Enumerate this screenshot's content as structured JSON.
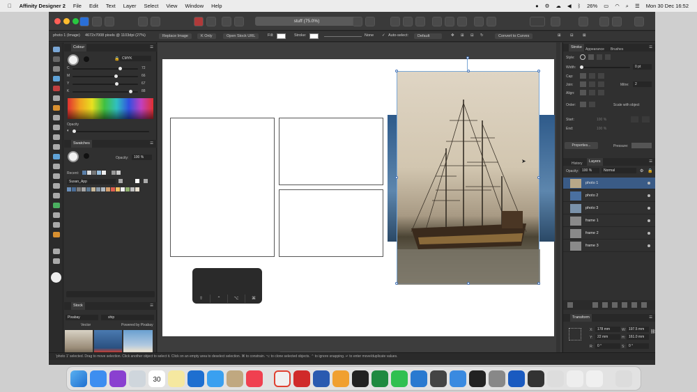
{
  "menubar": {
    "app_name": "Affinity Designer 2",
    "items": [
      "File",
      "Edit",
      "Text",
      "Layer",
      "Select",
      "View",
      "Window",
      "Help"
    ],
    "battery": "26%",
    "clock": "Mon 30 Dec  16:52"
  },
  "toolbar": {
    "document_title": "stuff (75.0%)"
  },
  "context_bar": {
    "info": "photo 1 (Image)",
    "dimensions": "4672x7008 pixels @ 1103dpi (27%)",
    "replace_image": "Replace Image",
    "k_only": "K Only",
    "open_stock_url": "Open Stock URL",
    "fill_label": "Fill:",
    "stroke_label": "Stroke:",
    "stroke_value": "None",
    "auto_select": "Auto-select:",
    "auto_select_value": "Default",
    "convert_to_curves": "Convert to Curves"
  },
  "colour_panel": {
    "tab": "Colour",
    "model": "CMYK",
    "channels": [
      {
        "name": "C",
        "value": "72",
        "level": 0.72
      },
      {
        "name": "M",
        "value": "66",
        "level": 0.66
      },
      {
        "name": "Y",
        "value": "67",
        "level": 0.67
      },
      {
        "name": "K",
        "value": "88",
        "level": 0.88
      }
    ],
    "opacity_label": "Opacity",
    "opacity_value": "100 %"
  },
  "swatches_panel": {
    "tab": "Swatches",
    "opacity_label": "Opacity:",
    "opacity_value": "100 %",
    "recent_label": "Recent:",
    "palette_name": "Susan_App",
    "recent_colors": [
      "#5a7ea8",
      "#e0e0e0",
      "#777777",
      "#9ac0e0",
      "#eeeeee",
      "#333333",
      "#9a9a9a",
      "#cccccc"
    ],
    "palette_colors": [
      "#6b8fb8",
      "#4a6c96",
      "#7d7d7d",
      "#a5a5a5",
      "#5e7a94",
      "#c8b89a",
      "#8a9aa8",
      "#b0b8c0",
      "#d4a070",
      "#e06050",
      "#f0c060",
      "#f0f0f0",
      "#90b070",
      "#c0c0c0",
      "#e8e0d0"
    ]
  },
  "stock_panel": {
    "tab": "Stock",
    "provider": "Pixabay",
    "search_query": "ship",
    "type": "Vector",
    "powered_by": "Powered by Pixabay"
  },
  "stroke_panel": {
    "tabs": [
      "Stroke",
      "Appearance",
      "Brushes"
    ],
    "style_label": "Style:",
    "width_label": "Width:",
    "width_value": "0 pt",
    "cap_label": "Cap:",
    "join_label": "Join:",
    "mitre_label": "Mitre:",
    "mitre_value": "2",
    "align_label": "Align:",
    "order_label": "Order:",
    "scale_with_object": "Scale with object",
    "start_label": "Start:",
    "start_value": "100 %",
    "end_label": "End:",
    "end_value": "100 %",
    "properties_button": "Properties...",
    "pressure_label": "Pressure:"
  },
  "layers_panel": {
    "tabs": [
      "History",
      "Layers"
    ],
    "opacity_label": "Opacity:",
    "opacity_value": "100 %",
    "blend_mode": "Normal",
    "layers": [
      {
        "name": "photo 1",
        "selected": true,
        "thumb": "#b8a888"
      },
      {
        "name": "photo 2",
        "selected": false,
        "thumb": "#4a70a0"
      },
      {
        "name": "photo 3",
        "selected": false,
        "thumb": "#7a92aa"
      },
      {
        "name": "frame 1",
        "selected": false,
        "thumb": "#8a8a8a"
      },
      {
        "name": "frame 2",
        "selected": false,
        "thumb": "#8a8a8a"
      },
      {
        "name": "frame 3",
        "selected": false,
        "thumb": "#8a8a8a"
      }
    ]
  },
  "transform_panel": {
    "tab": "Transform",
    "x_label": "X:",
    "x_value": "178 mm",
    "y_label": "Y:",
    "y_value": "22 mm",
    "w_label": "W:",
    "w_value": "197.5 mm",
    "h_label": "H:",
    "h_value": "161.0 mm",
    "r_label": "R:",
    "r_value": "0 °",
    "s_label": "S:",
    "s_value": "0 °"
  },
  "status_bar": {
    "text": "'photo 1' selected. Drag to move selection. Click another object to select it. Click on an empty area to deselect selection. ⌘ to constrain. ⌥ to clone selected objects. ⌃ to ignore snapping. ↵ to enter move/duplicate values."
  },
  "dock": {
    "calendar_day": "30"
  }
}
